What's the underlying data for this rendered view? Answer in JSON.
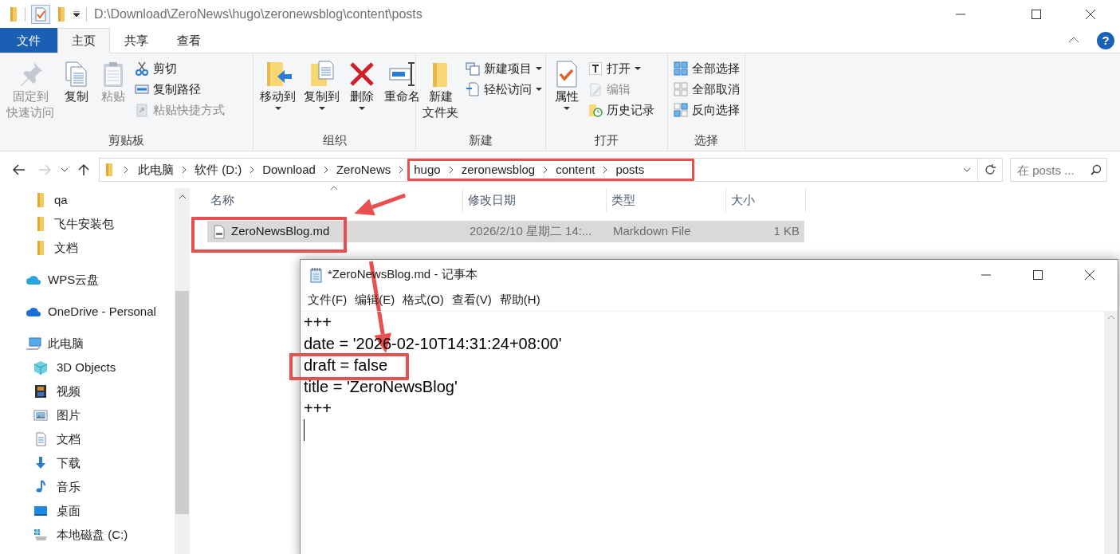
{
  "explorer": {
    "title_path": "D:\\Download\\ZeroNews\\hugo\\zeronewsblog\\content\\posts",
    "tabs": [
      {
        "label": "文件",
        "kind": "file_menu",
        "selected": false
      },
      {
        "label": "主页",
        "kind": "tab",
        "selected": true
      },
      {
        "label": "共享",
        "kind": "tab",
        "selected": false
      },
      {
        "label": "查看",
        "kind": "tab",
        "selected": false
      }
    ],
    "help_button": "?",
    "ribbon_groups": [
      {
        "label": "剪贴板",
        "items": [
          {
            "kind": "large",
            "lines": [
              "固定到",
              "快速访问"
            ],
            "disabled": true,
            "dropdown": false
          },
          {
            "kind": "large",
            "lines": [
              "复制"
            ],
            "disabled": false,
            "dropdown": false
          },
          {
            "kind": "large",
            "lines": [
              "粘贴"
            ],
            "disabled": true,
            "dropdown": false
          },
          {
            "kind": "small",
            "lines": [
              "剪切"
            ],
            "disabled": false,
            "dropdown": false
          },
          {
            "kind": "small",
            "lines": [
              "复制路径"
            ],
            "disabled": false,
            "dropdown": false
          },
          {
            "kind": "small",
            "lines": [
              "粘贴快捷方式"
            ],
            "disabled": true,
            "dropdown": false
          }
        ]
      },
      {
        "label": "组织",
        "items": [
          {
            "kind": "large",
            "lines": [
              "移动到"
            ],
            "disabled": false,
            "dropdown": true
          },
          {
            "kind": "large",
            "lines": [
              "复制到"
            ],
            "disabled": false,
            "dropdown": true
          },
          {
            "kind": "large",
            "lines": [
              "删除"
            ],
            "disabled": false,
            "dropdown": true
          },
          {
            "kind": "large",
            "lines": [
              "重命名"
            ],
            "disabled": false,
            "dropdown": false
          }
        ]
      },
      {
        "label": "新建",
        "items": [
          {
            "kind": "large",
            "lines": [
              "新建",
              "文件夹"
            ],
            "disabled": false,
            "dropdown": false
          },
          {
            "kind": "small",
            "lines": [
              "新建项目"
            ],
            "disabled": false,
            "dropdown": true
          },
          {
            "kind": "small",
            "lines": [
              "轻松访问"
            ],
            "disabled": false,
            "dropdown": true
          }
        ]
      },
      {
        "label": "打开",
        "items": [
          {
            "kind": "large",
            "lines": [
              "属性"
            ],
            "disabled": false,
            "dropdown": true
          },
          {
            "kind": "small",
            "lines": [
              "打开"
            ],
            "disabled": false,
            "dropdown": true
          },
          {
            "kind": "small",
            "lines": [
              "编辑"
            ],
            "disabled": true,
            "dropdown": false
          },
          {
            "kind": "small",
            "lines": [
              "历史记录"
            ],
            "disabled": false,
            "dropdown": false
          }
        ]
      },
      {
        "label": "选择",
        "items": [
          {
            "kind": "small",
            "lines": [
              "全部选择"
            ],
            "disabled": false,
            "dropdown": false
          },
          {
            "kind": "small",
            "lines": [
              "全部取消"
            ],
            "disabled": false,
            "dropdown": false
          },
          {
            "kind": "small",
            "lines": [
              "反向选择"
            ],
            "disabled": false,
            "dropdown": false
          }
        ]
      }
    ],
    "nav": {
      "back_disabled": false,
      "forward_disabled": true
    },
    "address": {
      "segments": [
        {
          "label": "此电脑"
        },
        {
          "label": "软件 (D:)"
        },
        {
          "label": "Download"
        },
        {
          "label": "ZeroNews"
        }
      ],
      "highlighted_segments": [
        {
          "label": "hugo"
        },
        {
          "label": "zeronewsblog"
        },
        {
          "label": "content"
        },
        {
          "label": "posts"
        }
      ]
    },
    "search": {
      "placeholder": "在 posts ..."
    },
    "sidebar": {
      "pinned": [
        {
          "label": "qa"
        },
        {
          "label": "飞牛安装包"
        },
        {
          "label": "文档"
        }
      ],
      "tree": [
        {
          "label": "WPS云盘"
        },
        {
          "label": "OneDrive - Personal"
        },
        {
          "label": "此电脑",
          "children": [
            {
              "label": "3D Objects"
            },
            {
              "label": "视频"
            },
            {
              "label": "图片"
            },
            {
              "label": "文档"
            },
            {
              "label": "下载"
            },
            {
              "label": "音乐"
            },
            {
              "label": "桌面"
            },
            {
              "label": "本地磁盘 (C:)"
            }
          ]
        }
      ]
    },
    "file_list": {
      "columns": [
        {
          "label": "名称",
          "sorted": true
        },
        {
          "label": "修改日期",
          "sorted": false
        },
        {
          "label": "类型",
          "sorted": false
        },
        {
          "label": "大小",
          "sorted": false
        }
      ],
      "rows": [
        {
          "name": "ZeroNewsBlog.md",
          "modified": "2026/2/10 星期二 14:...",
          "type": "Markdown File",
          "size": "1 KB",
          "selected": true,
          "highlighted": true
        }
      ]
    }
  },
  "notepad": {
    "title": "*ZeroNewsBlog.md - 记事本",
    "menus": [
      "文件(F)",
      "编辑(E)",
      "格式(O)",
      "查看(V)",
      "帮助(H)"
    ],
    "lines": [
      {
        "text": "+++",
        "highlighted": false
      },
      {
        "text": "date = '2026-02-10T14:31:24+08:00'",
        "highlighted": false
      },
      {
        "text": "draft = false",
        "highlighted": true
      },
      {
        "text": "title = 'ZeroNewsBlog'",
        "highlighted": false
      },
      {
        "text": "+++",
        "highlighted": false
      }
    ]
  }
}
